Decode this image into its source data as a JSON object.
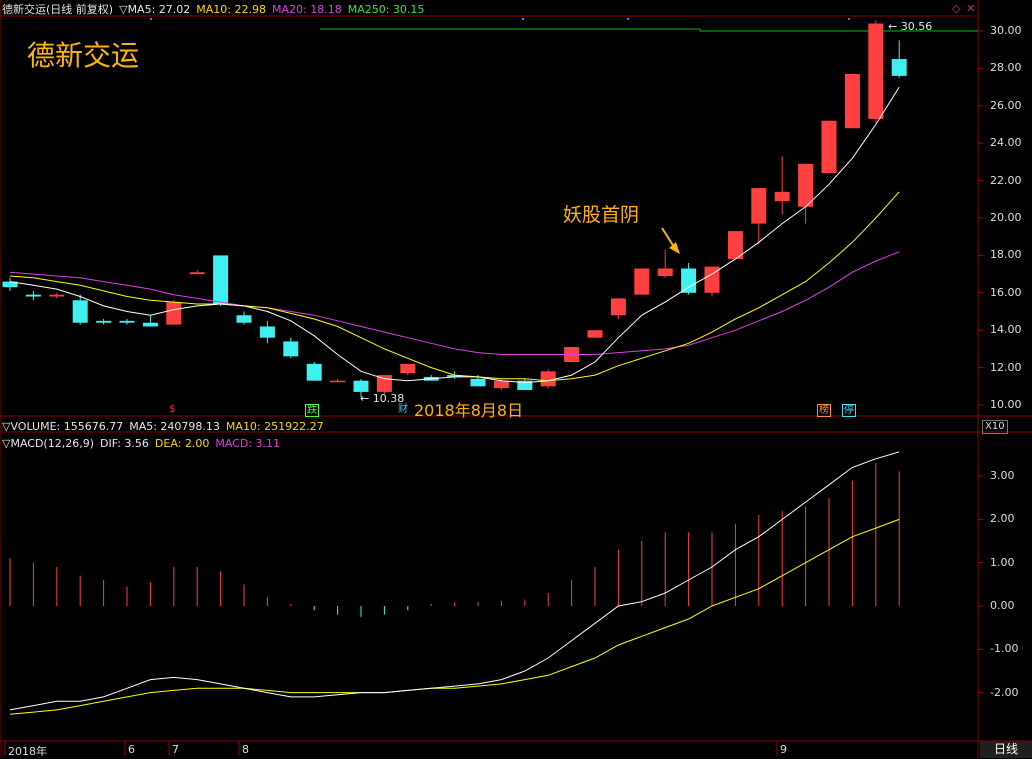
{
  "main_header": {
    "title": "德新交运(日线 前复权)",
    "indicator_mark": "▽",
    "ma5": "MA5: 27.02",
    "ma10": "MA10: 22.98",
    "ma20": "MA20: 18.18",
    "ma250": "MA250: 30.15"
  },
  "stock_overlay_title": "德新交运",
  "annotations": {
    "first_yin": "妖股首阴",
    "date_note": "2018年8月8日",
    "high_marker": "30.56",
    "low_marker": "10.38"
  },
  "event_tags": [
    {
      "text": "$",
      "color": "#ff3030"
    },
    {
      "text": "跌",
      "color": "#40ff40"
    },
    {
      "text": "财",
      "color": "#40c0ff"
    },
    {
      "text": "榜",
      "color": "#ff9040"
    },
    {
      "text": "停",
      "color": "#40e0ff"
    }
  ],
  "volume_header": {
    "label": "▽VOLUME: 155676.77",
    "ma5": "MA5: 240798.13",
    "ma10": "MA10: 251922.27",
    "scale": "X10"
  },
  "macd_header": {
    "label": "▽MACD(12,26,9)",
    "dif": "DIF: 3.56",
    "dea": "DEA: 2.00",
    "macd": "MACD: 3.11"
  },
  "price_axis": [
    "30.00",
    "28.00",
    "26.00",
    "24.00",
    "22.00",
    "20.00",
    "18.00",
    "16.00",
    "14.00",
    "12.00",
    "10.00"
  ],
  "macd_axis": [
    "3.00",
    "2.00",
    "1.00",
    "0.00",
    "-1.00",
    "-2.00"
  ],
  "time_axis": [
    "2018年",
    "6",
    "7",
    "8",
    "9"
  ],
  "period_button": "日线",
  "colors": {
    "up": "#ff4040",
    "down": "#40f0f0",
    "ma5": "#ffffff",
    "ma10": "#ffff00",
    "ma20": "#e040e0",
    "ma250": "#00c000",
    "title": "#ffb400"
  },
  "chart_data": {
    "type": "candlestick",
    "candles": [
      {
        "o": 16.6,
        "h": 16.8,
        "l": 16.1,
        "c": 16.3
      },
      {
        "o": 15.9,
        "h": 16.1,
        "l": 15.6,
        "c": 15.8
      },
      {
        "o": 15.8,
        "h": 16.0,
        "l": 15.7,
        "c": 15.9
      },
      {
        "o": 15.6,
        "h": 15.9,
        "l": 14.3,
        "c": 14.4
      },
      {
        "o": 14.5,
        "h": 14.6,
        "l": 14.3,
        "c": 14.4
      },
      {
        "o": 14.5,
        "h": 14.6,
        "l": 14.3,
        "c": 14.4
      },
      {
        "o": 14.4,
        "h": 14.8,
        "l": 14.2,
        "c": 14.2
      },
      {
        "o": 14.3,
        "h": 15.6,
        "l": 14.3,
        "c": 15.5
      },
      {
        "o": 17.0,
        "h": 17.2,
        "l": 17.0,
        "c": 17.1
      },
      {
        "o": 18.0,
        "h": 18.0,
        "l": 15.3,
        "c": 15.4
      },
      {
        "o": 14.8,
        "h": 15.0,
        "l": 14.3,
        "c": 14.4
      },
      {
        "o": 14.2,
        "h": 14.5,
        "l": 13.3,
        "c": 13.6
      },
      {
        "o": 13.4,
        "h": 13.6,
        "l": 12.5,
        "c": 12.6
      },
      {
        "o": 12.2,
        "h": 12.3,
        "l": 11.3,
        "c": 11.3
      },
      {
        "o": 11.3,
        "h": 11.4,
        "l": 11.2,
        "c": 11.3
      },
      {
        "o": 11.3,
        "h": 11.4,
        "l": 10.4,
        "c": 10.7
      },
      {
        "o": 10.7,
        "h": 11.6,
        "l": 10.6,
        "c": 11.6
      },
      {
        "o": 11.7,
        "h": 12.2,
        "l": 11.6,
        "c": 12.2
      },
      {
        "o": 11.5,
        "h": 11.6,
        "l": 11.3,
        "c": 11.3
      },
      {
        "o": 11.6,
        "h": 11.8,
        "l": 11.4,
        "c": 11.5
      },
      {
        "o": 11.4,
        "h": 11.6,
        "l": 11.0,
        "c": 11.0
      },
      {
        "o": 10.9,
        "h": 11.4,
        "l": 10.8,
        "c": 11.3
      },
      {
        "o": 11.3,
        "h": 11.4,
        "l": 10.8,
        "c": 10.8
      },
      {
        "o": 11.0,
        "h": 11.9,
        "l": 10.9,
        "c": 11.8
      },
      {
        "o": 12.3,
        "h": 13.1,
        "l": 12.3,
        "c": 13.1
      },
      {
        "o": 13.6,
        "h": 14.0,
        "l": 13.6,
        "c": 14.0
      },
      {
        "o": 14.8,
        "h": 15.7,
        "l": 14.6,
        "c": 15.7
      },
      {
        "o": 15.9,
        "h": 17.3,
        "l": 15.9,
        "c": 17.3
      },
      {
        "o": 16.9,
        "h": 18.3,
        "l": 16.8,
        "c": 17.3
      },
      {
        "o": 17.3,
        "h": 17.6,
        "l": 15.9,
        "c": 16.0
      },
      {
        "o": 16.0,
        "h": 17.4,
        "l": 15.8,
        "c": 17.4
      },
      {
        "o": 17.8,
        "h": 19.3,
        "l": 17.8,
        "c": 19.3
      },
      {
        "o": 19.7,
        "h": 21.6,
        "l": 18.6,
        "c": 21.6
      },
      {
        "o": 20.9,
        "h": 23.3,
        "l": 20.2,
        "c": 21.4
      },
      {
        "o": 20.6,
        "h": 22.9,
        "l": 19.7,
        "c": 22.9
      },
      {
        "o": 22.4,
        "h": 25.2,
        "l": 22.4,
        "c": 25.2
      },
      {
        "o": 24.8,
        "h": 27.7,
        "l": 24.8,
        "c": 27.7
      },
      {
        "o": 25.3,
        "h": 30.56,
        "l": 25.1,
        "c": 30.4
      },
      {
        "o": 28.5,
        "h": 29.5,
        "l": 27.5,
        "c": 27.6
      }
    ],
    "ma5": [
      16.6,
      16.4,
      16.2,
      15.8,
      15.3,
      15.0,
      14.8,
      15.1,
      15.3,
      15.4,
      15.3,
      15.0,
      14.5,
      13.7,
      12.7,
      11.8,
      11.4,
      11.3,
      11.4,
      11.5,
      11.5,
      11.3,
      11.2,
      11.3,
      11.6,
      12.3,
      13.6,
      14.8,
      15.5,
      16.3,
      17.0,
      17.8,
      18.7,
      19.7,
      20.6,
      21.8,
      23.2,
      25.0,
      27.0
    ],
    "ma10": [
      16.9,
      16.8,
      16.6,
      16.4,
      16.1,
      15.8,
      15.6,
      15.5,
      15.4,
      15.4,
      15.3,
      15.2,
      14.9,
      14.6,
      14.2,
      13.6,
      13.0,
      12.5,
      12.0,
      11.6,
      11.5,
      11.4,
      11.4,
      11.3,
      11.4,
      11.6,
      12.1,
      12.5,
      12.9,
      13.3,
      13.9,
      14.6,
      15.2,
      15.9,
      16.6,
      17.6,
      18.7,
      20.0,
      21.4
    ],
    "ma20": [
      17.1,
      17.0,
      16.9,
      16.8,
      16.6,
      16.4,
      16.2,
      15.9,
      15.7,
      15.5,
      15.3,
      15.2,
      15.0,
      14.8,
      14.5,
      14.2,
      13.9,
      13.6,
      13.3,
      13.0,
      12.8,
      12.7,
      12.7,
      12.7,
      12.7,
      12.7,
      12.8,
      12.9,
      13.0,
      13.2,
      13.6,
      14.0,
      14.5,
      15.0,
      15.6,
      16.3,
      17.1,
      17.7,
      18.2
    ],
    "ma250": 30.15,
    "volume": {
      "last": 155676.77,
      "ma5": 240798.13,
      "ma10": 251922.27
    },
    "macd": {
      "dif": [
        -2.4,
        -2.3,
        -2.2,
        -2.2,
        -2.1,
        -1.9,
        -1.7,
        -1.65,
        -1.7,
        -1.8,
        -1.9,
        -2.0,
        -2.1,
        -2.1,
        -2.05,
        -2.0,
        -2.0,
        -1.95,
        -1.9,
        -1.85,
        -1.8,
        -1.7,
        -1.5,
        -1.2,
        -0.8,
        -0.4,
        0.0,
        0.1,
        0.3,
        0.6,
        0.9,
        1.3,
        1.6,
        2.0,
        2.4,
        2.8,
        3.2,
        3.4,
        3.56
      ],
      "dea": [
        -2.5,
        -2.45,
        -2.4,
        -2.3,
        -2.2,
        -2.1,
        -2.0,
        -1.95,
        -1.9,
        -1.9,
        -1.9,
        -1.95,
        -2.0,
        -2.0,
        -2.0,
        -2.0,
        -2.0,
        -1.95,
        -1.9,
        -1.9,
        -1.85,
        -1.8,
        -1.7,
        -1.6,
        -1.4,
        -1.2,
        -0.9,
        -0.7,
        -0.5,
        -0.3,
        0.0,
        0.2,
        0.4,
        0.7,
        1.0,
        1.3,
        1.6,
        1.8,
        2.0
      ],
      "hist": [
        1.1,
        1.0,
        0.9,
        0.7,
        0.6,
        0.45,
        0.55,
        0.9,
        0.9,
        0.8,
        0.5,
        0.2,
        0.05,
        -0.1,
        -0.2,
        -0.25,
        -0.2,
        -0.1,
        0.05,
        0.08,
        0.1,
        0.12,
        0.15,
        0.3,
        0.6,
        0.9,
        1.3,
        1.5,
        1.7,
        1.7,
        1.7,
        1.9,
        2.1,
        2.2,
        2.3,
        2.5,
        2.9,
        3.3,
        3.11
      ]
    },
    "ylim_price": [
      10,
      30.5
    ],
    "ylim_macd": [
      -2.6,
      3.6
    ]
  }
}
